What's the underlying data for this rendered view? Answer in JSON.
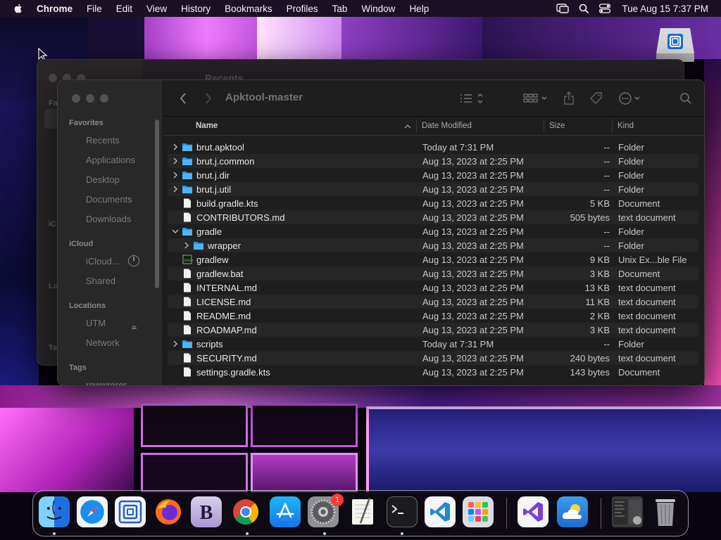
{
  "menubar": {
    "app_name": "Chrome",
    "items": [
      "File",
      "Edit",
      "View",
      "History",
      "Bookmarks",
      "Profiles",
      "Tab",
      "Window",
      "Help"
    ],
    "clock": "Tue Aug 15  7:37 PM"
  },
  "back_window": {
    "title": "Recents",
    "sidebar_labels": [
      "Fa",
      "iC",
      "Lo",
      "Ta"
    ]
  },
  "sidebar": {
    "favorites_header": "Favorites",
    "favorites": [
      "Recents",
      "Applications",
      "Desktop",
      "Documents",
      "Downloads"
    ],
    "icloud_header": "iCloud",
    "icloud": [
      "iCloud...",
      "Shared"
    ],
    "locations_header": "Locations",
    "locations": [
      "UTM",
      "Network"
    ],
    "tags_header": "Tags",
    "tags": [
      "rewwrerer"
    ]
  },
  "window": {
    "title": "Apktool-master"
  },
  "columns": {
    "name": "Name",
    "date": "Date Modified",
    "size": "Size",
    "kind": "Kind"
  },
  "files": [
    {
      "name": "brut.apktool",
      "date": "Today at 7:31 PM",
      "size": "--",
      "kind": "Folder",
      "type": "folder",
      "disclosure": "closed",
      "indent": 0
    },
    {
      "name": "brut.j.common",
      "date": "Aug 13, 2023 at 2:25 PM",
      "size": "--",
      "kind": "Folder",
      "type": "folder",
      "disclosure": "closed",
      "indent": 0
    },
    {
      "name": "brut.j.dir",
      "date": "Aug 13, 2023 at 2:25 PM",
      "size": "--",
      "kind": "Folder",
      "type": "folder",
      "disclosure": "closed",
      "indent": 0
    },
    {
      "name": "brut.j.util",
      "date": "Aug 13, 2023 at 2:25 PM",
      "size": "--",
      "kind": "Folder",
      "type": "folder",
      "disclosure": "closed",
      "indent": 0
    },
    {
      "name": "build.gradle.kts",
      "date": "Aug 13, 2023 at 2:25 PM",
      "size": "5 KB",
      "kind": "Document",
      "type": "file",
      "disclosure": "none",
      "indent": 0
    },
    {
      "name": "CONTRIBUTORS.md",
      "date": "Aug 13, 2023 at 2:25 PM",
      "size": "505 bytes",
      "kind": "text document",
      "type": "file",
      "disclosure": "none",
      "indent": 0
    },
    {
      "name": "gradle",
      "date": "Aug 13, 2023 at 2:25 PM",
      "size": "--",
      "kind": "Folder",
      "type": "folder",
      "disclosure": "open",
      "indent": 0
    },
    {
      "name": "wrapper",
      "date": "Aug 13, 2023 at 2:25 PM",
      "size": "--",
      "kind": "Folder",
      "type": "folder",
      "disclosure": "closed",
      "indent": 1
    },
    {
      "name": "gradlew",
      "date": "Aug 13, 2023 at 2:25 PM",
      "size": "9 KB",
      "kind": "Unix Ex...ble File",
      "type": "exec",
      "disclosure": "none",
      "indent": 0
    },
    {
      "name": "gradlew.bat",
      "date": "Aug 13, 2023 at 2:25 PM",
      "size": "3 KB",
      "kind": "Document",
      "type": "file",
      "disclosure": "none",
      "indent": 0
    },
    {
      "name": "INTERNAL.md",
      "date": "Aug 13, 2023 at 2:25 PM",
      "size": "13 KB",
      "kind": "text document",
      "type": "file",
      "disclosure": "none",
      "indent": 0
    },
    {
      "name": "LICENSE.md",
      "date": "Aug 13, 2023 at 2:25 PM",
      "size": "11 KB",
      "kind": "text document",
      "type": "file",
      "disclosure": "none",
      "indent": 0
    },
    {
      "name": "README.md",
      "date": "Aug 13, 2023 at 2:25 PM",
      "size": "2 KB",
      "kind": "text document",
      "type": "file",
      "disclosure": "none",
      "indent": 0
    },
    {
      "name": "ROADMAP.md",
      "date": "Aug 13, 2023 at 2:25 PM",
      "size": "3 KB",
      "kind": "text document",
      "type": "file",
      "disclosure": "none",
      "indent": 0
    },
    {
      "name": "scripts",
      "date": "Today at 7:31 PM",
      "size": "--",
      "kind": "Folder",
      "type": "folder",
      "disclosure": "closed",
      "indent": 0
    },
    {
      "name": "SECURITY.md",
      "date": "Aug 13, 2023 at 2:25 PM",
      "size": "240 bytes",
      "kind": "text document",
      "type": "file",
      "disclosure": "none",
      "indent": 0
    },
    {
      "name": "settings.gradle.kts",
      "date": "Aug 13, 2023 at 2:25 PM",
      "size": "143 bytes",
      "kind": "Document",
      "type": "file",
      "disclosure": "none",
      "indent": 0
    }
  ],
  "dock": {
    "apps": [
      "finder-icon",
      "safari-icon",
      "utm-icon",
      "firefox-icon",
      "bbedit-icon",
      "chrome-icon",
      "app-store-icon",
      "system-settings-icon",
      "textedit-icon",
      "terminal-icon",
      "vscode-icon",
      "launchpad-icon",
      "visual-studio-icon",
      "weather-icon",
      "downloads-stack-icon",
      "trash-icon"
    ],
    "settings_badge": "1"
  },
  "colors": {
    "folder_blue": "#1e9bf0",
    "accent": "#0a84ff",
    "badge_red": "#ff3b30"
  }
}
